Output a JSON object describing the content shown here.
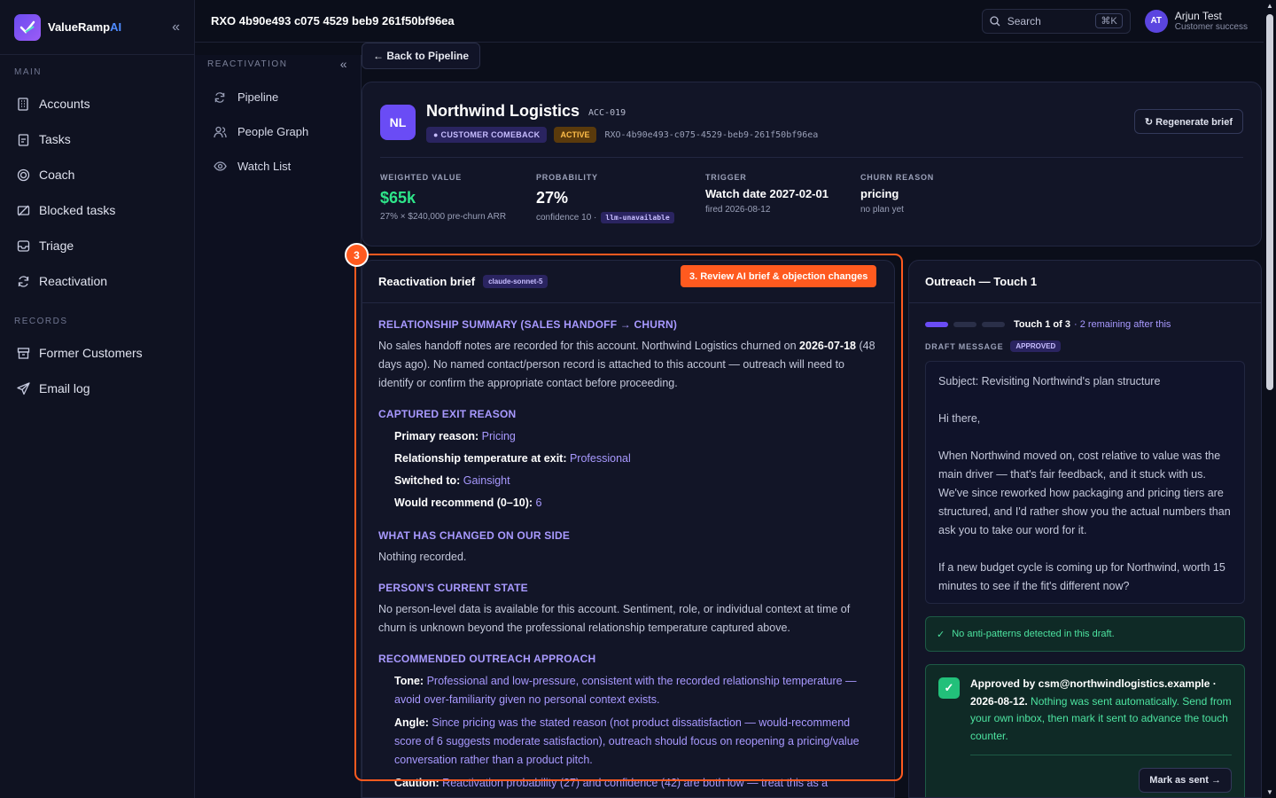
{
  "brand": {
    "name_main": "ValueRamp",
    "name_ai": "AI"
  },
  "sidebar": {
    "main_label": "MAIN",
    "main_items": [
      {
        "label": "Accounts",
        "icon": "building-icon"
      },
      {
        "label": "Tasks",
        "icon": "clipboard-icon"
      },
      {
        "label": "Coach",
        "icon": "target-icon"
      },
      {
        "label": "Blocked tasks",
        "icon": "blocked-icon"
      },
      {
        "label": "Triage",
        "icon": "inbox-icon"
      },
      {
        "label": "Reactivation",
        "icon": "refresh-icon"
      }
    ],
    "records_label": "RECORDS",
    "record_items": [
      {
        "label": "Former Customers",
        "icon": "archive-icon"
      },
      {
        "label": "Email log",
        "icon": "send-icon"
      }
    ]
  },
  "subbar": {
    "label": "REACTIVATION",
    "items": [
      {
        "label": "Pipeline",
        "icon": "refresh-icon"
      },
      {
        "label": "People Graph",
        "icon": "people-icon"
      },
      {
        "label": "Watch List",
        "icon": "eye-icon"
      }
    ]
  },
  "topbar": {
    "title": "RXO 4b90e493 c075 4529 beb9 261f50bf96ea",
    "search_placeholder": "Search",
    "search_kbd": "⌘K",
    "user_initials": "AT",
    "user_name": "Arjun Test",
    "user_role": "Customer success"
  },
  "back_label": "← Back to Pipeline",
  "account": {
    "initials": "NL",
    "name": "Northwind Logistics",
    "id": "ACC-019",
    "badge_comeback": "● CUSTOMER COMEBACK",
    "badge_active": "ACTIVE",
    "rxo_code": "RXO-4b90e493-c075-4529-beb9-261f50bf96ea",
    "regen_label": "↻ Regenerate brief"
  },
  "metrics": {
    "weighted": {
      "label": "WEIGHTED VALUE",
      "value": "$65k",
      "sub": "27% × $240,000 pre-churn ARR"
    },
    "probability": {
      "label": "PROBABILITY",
      "value": "27%",
      "sub": "confidence 10 ·",
      "pill": "llm-unavailable"
    },
    "trigger": {
      "label": "TRIGGER",
      "value": "Watch date 2027-02-01",
      "sub": "fired 2026-08-12"
    },
    "churn": {
      "label": "CHURN REASON",
      "value": "pricing",
      "sub": "no plan yet"
    }
  },
  "brief": {
    "title": "Reactivation brief",
    "model": "claude-sonnet-5",
    "s1_title": "RELATIONSHIP SUMMARY (SALES HANDOFF → CHURN)",
    "s1_a": "No sales handoff notes are recorded for this account. Northwind Logistics churned on ",
    "s1_date": "2026-07-18",
    "s1_b": " (48 days ago). No named contact/person record is attached to this account — outreach will need to identify or confirm the appropriate contact before proceeding.",
    "s2_title": "CAPTURED EXIT REASON",
    "s2_items": [
      {
        "k": "Primary reason:",
        "v": " Pricing"
      },
      {
        "k": "Relationship temperature at exit:",
        "v": " Professional"
      },
      {
        "k": "Switched to:",
        "v": " Gainsight"
      },
      {
        "k": "Would recommend (0–10):",
        "v": " 6"
      }
    ],
    "s3_title": "WHAT HAS CHANGED ON OUR SIDE",
    "s3_text": "Nothing recorded.",
    "s4_title": "PERSON'S CURRENT STATE",
    "s4_text": "No person-level data is available for this account. Sentiment, role, or individual context at time of churn is unknown beyond the professional relationship temperature captured above.",
    "s5_title": "RECOMMENDED OUTREACH APPROACH",
    "s5_tone_k": "Tone:",
    "s5_tone_v": " Professional and low-pressure, consistent with the recorded relationship temperature — avoid over-familiarity given no personal context exists.",
    "s5_angle_k": "Angle:",
    "s5_angle_v": " Since pricing was the stated reason (not product dissatisfaction — would-recommend score of 6 suggests moderate satisfaction), outreach should focus on reopening a pricing/value conversation rather than a product pitch.",
    "s5_caution_k": "Caution:",
    "s5_caution_v": " Reactivation probability (27) and confidence (42) are both low — treat this as a"
  },
  "highlight": {
    "number": "3",
    "tag": "3. Review AI brief & objection changes"
  },
  "outreach": {
    "title": "Outreach — Touch 1",
    "touch_text": "Touch 1 of 3",
    "touch_rem": "· 2 remaining after this",
    "progress": {
      "current": 1,
      "total": 3
    },
    "draft_label": "DRAFT MESSAGE",
    "approved_label": "APPROVED",
    "msg_subject": "Subject: Revisiting Northwind's plan structure",
    "msg_greet": "Hi there,",
    "msg_p1": "When Northwind moved on, cost relative to value was the main driver — that's fair feedback, and it stuck with us. We've since reworked how packaging and pricing tiers are structured, and I'd rather show you the actual numbers than ask you to take our word for it.",
    "msg_p2": "If a new budget cycle is coming up for Northwind, worth 15 minutes to see if the fit's different now?",
    "ok_text": "No anti-patterns detected in this draft.",
    "appr_bold": "Approved by csm@northwindlogistics.example · 2026-08-12.",
    "appr_rest": " Nothing was sent automatically. Send from your own inbox, then mark it sent to advance the touch counter.",
    "mark_sent": "Mark as sent →"
  }
}
